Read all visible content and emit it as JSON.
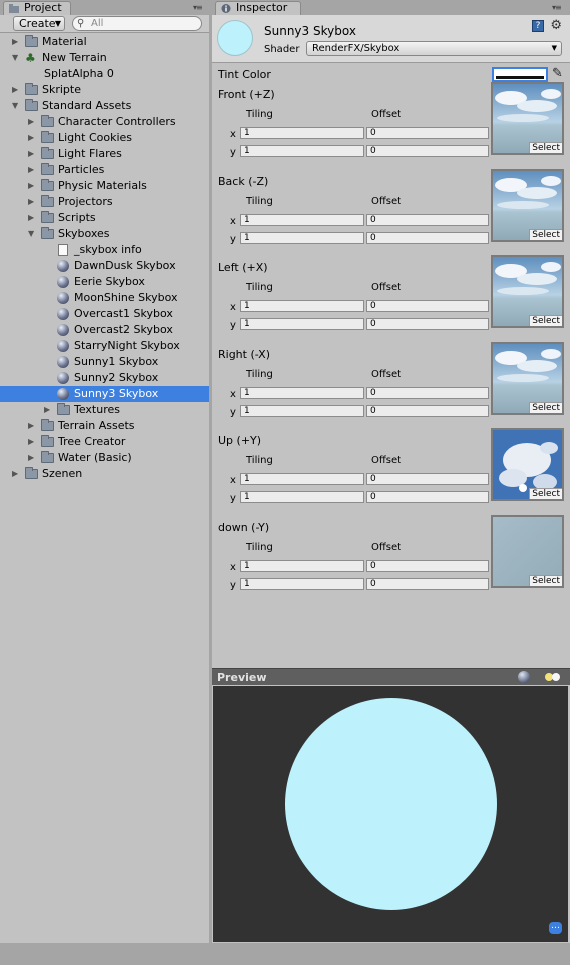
{
  "project": {
    "tab_label": "Project",
    "create_label": "Create",
    "search_placeholder": "All",
    "tree": [
      {
        "label": "Material",
        "type": "folder",
        "depth": 0,
        "fold": "closed"
      },
      {
        "label": "New Terrain",
        "type": "terrain",
        "depth": 0,
        "fold": "open"
      },
      {
        "label": "SplatAlpha 0",
        "type": "none",
        "depth": 1,
        "fold": "none"
      },
      {
        "label": "Skripte",
        "type": "folder",
        "depth": 0,
        "fold": "closed"
      },
      {
        "label": "Standard Assets",
        "type": "folder",
        "depth": 0,
        "fold": "open"
      },
      {
        "label": "Character Controllers",
        "type": "folder",
        "depth": 1,
        "fold": "closed"
      },
      {
        "label": "Light Cookies",
        "type": "folder",
        "depth": 1,
        "fold": "closed"
      },
      {
        "label": "Light Flares",
        "type": "folder",
        "depth": 1,
        "fold": "closed"
      },
      {
        "label": "Particles",
        "type": "folder",
        "depth": 1,
        "fold": "closed"
      },
      {
        "label": "Physic Materials",
        "type": "folder",
        "depth": 1,
        "fold": "closed"
      },
      {
        "label": "Projectors",
        "type": "folder",
        "depth": 1,
        "fold": "closed"
      },
      {
        "label": "Scripts",
        "type": "folder",
        "depth": 1,
        "fold": "closed"
      },
      {
        "label": "Skyboxes",
        "type": "folder",
        "depth": 1,
        "fold": "open"
      },
      {
        "label": "_skybox info",
        "type": "doc",
        "depth": 2,
        "fold": "none"
      },
      {
        "label": "DawnDusk Skybox",
        "type": "material",
        "depth": 2,
        "fold": "none"
      },
      {
        "label": "Eerie Skybox",
        "type": "material",
        "depth": 2,
        "fold": "none"
      },
      {
        "label": "MoonShine Skybox",
        "type": "material",
        "depth": 2,
        "fold": "none"
      },
      {
        "label": "Overcast1 Skybox",
        "type": "material",
        "depth": 2,
        "fold": "none"
      },
      {
        "label": "Overcast2 Skybox",
        "type": "material",
        "depth": 2,
        "fold": "none"
      },
      {
        "label": "StarryNight Skybox",
        "type": "material",
        "depth": 2,
        "fold": "none"
      },
      {
        "label": "Sunny1 Skybox",
        "type": "material",
        "depth": 2,
        "fold": "none"
      },
      {
        "label": "Sunny2 Skybox",
        "type": "material",
        "depth": 2,
        "fold": "none"
      },
      {
        "label": "Sunny3 Skybox",
        "type": "material",
        "depth": 2,
        "fold": "none",
        "selected": true
      },
      {
        "label": "Textures",
        "type": "folder",
        "depth": 2,
        "fold": "closed"
      },
      {
        "label": "Terrain Assets",
        "type": "folder",
        "depth": 1,
        "fold": "closed"
      },
      {
        "label": "Tree Creator",
        "type": "folder",
        "depth": 1,
        "fold": "closed"
      },
      {
        "label": "Water (Basic)",
        "type": "folder",
        "depth": 1,
        "fold": "closed"
      },
      {
        "label": "Szenen",
        "type": "folder",
        "depth": 0,
        "fold": "closed"
      }
    ]
  },
  "inspector": {
    "tab_label": "Inspector",
    "material_name": "Sunny3 Skybox",
    "shader_label": "Shader",
    "shader_value": "RenderFX/Skybox",
    "tint_label": "Tint Color",
    "tiling_label": "Tiling",
    "offset_label": "Offset",
    "axis_x": "x",
    "axis_y": "y",
    "select_label": "Select",
    "slots": [
      {
        "title": "Front (+Z)",
        "tiling_x": "1",
        "tiling_y": "1",
        "offset_x": "0",
        "offset_y": "0",
        "texture": "clouds-horizon"
      },
      {
        "title": "Back (-Z)",
        "tiling_x": "1",
        "tiling_y": "1",
        "offset_x": "0",
        "offset_y": "0",
        "texture": "clouds-horizon"
      },
      {
        "title": "Left (+X)",
        "tiling_x": "1",
        "tiling_y": "1",
        "offset_x": "0",
        "offset_y": "0",
        "texture": "clouds-horizon"
      },
      {
        "title": "Right (-X)",
        "tiling_x": "1",
        "tiling_y": "1",
        "offset_x": "0",
        "offset_y": "0",
        "texture": "clouds-horizon"
      },
      {
        "title": "Up (+Y)",
        "tiling_x": "1",
        "tiling_y": "1",
        "offset_x": "0",
        "offset_y": "0",
        "texture": "clouds-sky"
      },
      {
        "title": "down (-Y)",
        "tiling_x": "1",
        "tiling_y": "1",
        "offset_x": "0",
        "offset_y": "0",
        "texture": "flat"
      }
    ],
    "preview_title": "Preview"
  },
  "colors": {
    "selection": "#3d80df",
    "panel_bg": "#c2c2c2",
    "preview_bg": "#323232",
    "sky_sphere": "#bdf1fb"
  }
}
